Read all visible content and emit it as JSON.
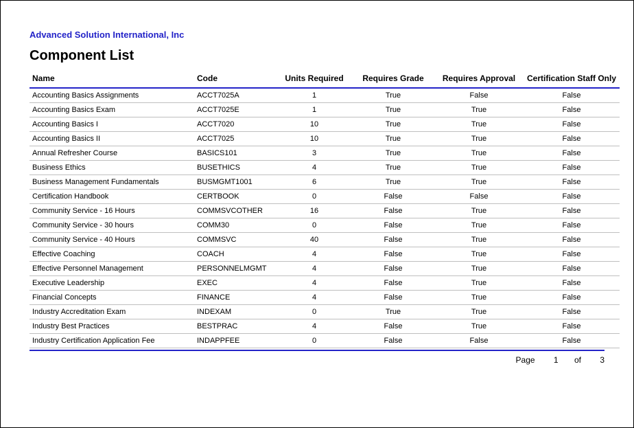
{
  "company": "Advanced Solution International, Inc",
  "title": "Component List",
  "columns": {
    "name": "Name",
    "code": "Code",
    "units": "Units Required",
    "grade": "Requires Grade",
    "approval": "Requires Approval",
    "staff": "Certification Staff Only"
  },
  "rows": [
    {
      "name": "Accounting Basics Assignments",
      "code": "ACCT7025A",
      "units": "1",
      "grade": "True",
      "approval": "False",
      "staff": "False"
    },
    {
      "name": "Accounting Basics Exam",
      "code": "ACCT7025E",
      "units": "1",
      "grade": "True",
      "approval": "True",
      "staff": "False"
    },
    {
      "name": "Accounting Basics I",
      "code": "ACCT7020",
      "units": "10",
      "grade": "True",
      "approval": "True",
      "staff": "False"
    },
    {
      "name": "Accounting Basics II",
      "code": "ACCT7025",
      "units": "10",
      "grade": "True",
      "approval": "True",
      "staff": "False"
    },
    {
      "name": "Annual Refresher Course",
      "code": "BASICS101",
      "units": "3",
      "grade": "True",
      "approval": "True",
      "staff": "False"
    },
    {
      "name": "Business Ethics",
      "code": "BUSETHICS",
      "units": "4",
      "grade": "True",
      "approval": "True",
      "staff": "False"
    },
    {
      "name": "Business Management Fundamentals",
      "code": "BUSMGMT1001",
      "units": "6",
      "grade": "True",
      "approval": "True",
      "staff": "False"
    },
    {
      "name": "Certification Handbook",
      "code": "CERTBOOK",
      "units": "0",
      "grade": "False",
      "approval": "False",
      "staff": "False"
    },
    {
      "name": "Community Service - 16 Hours",
      "code": "COMMSVCOTHER",
      "units": "16",
      "grade": "False",
      "approval": "True",
      "staff": "False"
    },
    {
      "name": "Community Service - 30 hours",
      "code": "COMM30",
      "units": "0",
      "grade": "False",
      "approval": "True",
      "staff": "False"
    },
    {
      "name": "Community Service - 40 Hours",
      "code": "COMMSVC",
      "units": "40",
      "grade": "False",
      "approval": "True",
      "staff": "False"
    },
    {
      "name": "Effective Coaching",
      "code": "COACH",
      "units": "4",
      "grade": "False",
      "approval": "True",
      "staff": "False"
    },
    {
      "name": "Effective Personnel Management",
      "code": "PERSONNELMGMT",
      "units": "4",
      "grade": "False",
      "approval": "True",
      "staff": "False"
    },
    {
      "name": "Executive Leadership",
      "code": "EXEC",
      "units": "4",
      "grade": "False",
      "approval": "True",
      "staff": "False"
    },
    {
      "name": "Financial Concepts",
      "code": "FINANCE",
      "units": "4",
      "grade": "False",
      "approval": "True",
      "staff": "False"
    },
    {
      "name": "Industry Accreditation Exam",
      "code": "INDEXAM",
      "units": "0",
      "grade": "True",
      "approval": "True",
      "staff": "False"
    },
    {
      "name": "Industry Best Practices",
      "code": "BESTPRAC",
      "units": "4",
      "grade": "False",
      "approval": "True",
      "staff": "False"
    },
    {
      "name": "Industry Certification Application Fee",
      "code": "INDAPPFEE",
      "units": "0",
      "grade": "False",
      "approval": "False",
      "staff": "False"
    }
  ],
  "footer": {
    "page_label": "Page",
    "page_num": "1",
    "of_label": "of",
    "page_total": "3"
  }
}
